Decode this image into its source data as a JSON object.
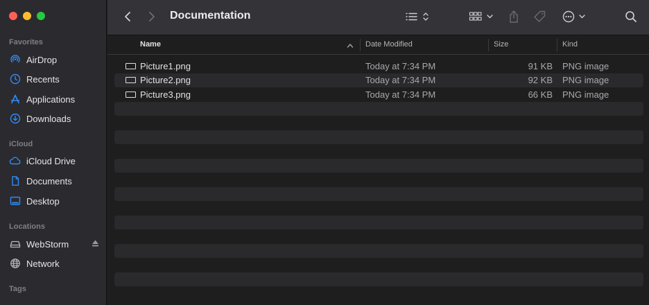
{
  "window": {
    "title": "Documentation"
  },
  "colors": {
    "accent": "#2f8cf5",
    "sidebar_bg": "#2b2a2f",
    "toolbar_bg": "#343338",
    "content_bg": "#1e1e1e"
  },
  "sidebar": {
    "sections": [
      {
        "title": "Favorites"
      },
      {
        "title": "iCloud"
      },
      {
        "title": "Locations"
      },
      {
        "title": "Tags"
      }
    ],
    "favorites": [
      {
        "label": "AirDrop",
        "icon": "airdrop-icon"
      },
      {
        "label": "Recents",
        "icon": "clock-icon"
      },
      {
        "label": "Applications",
        "icon": "applications-icon"
      },
      {
        "label": "Downloads",
        "icon": "downloads-icon"
      }
    ],
    "icloud": [
      {
        "label": "iCloud Drive",
        "icon": "cloud-icon"
      },
      {
        "label": "Documents",
        "icon": "document-icon"
      },
      {
        "label": "Desktop",
        "icon": "desktop-icon"
      }
    ],
    "locations": [
      {
        "label": "WebStorm",
        "icon": "drive-icon",
        "eject": "eject-icon"
      },
      {
        "label": "Network",
        "icon": "globe-icon"
      }
    ]
  },
  "toolbar": {
    "back": "chevron-left-icon",
    "forward": "chevron-right-icon",
    "view": "list-view-icon",
    "group": "grid-group-icon",
    "share": "share-icon",
    "tag": "tag-icon",
    "more": "ellipsis-circle-icon",
    "search": "search-icon"
  },
  "table": {
    "columns": {
      "name": "Name",
      "date": "Date Modified",
      "size": "Size",
      "kind": "Kind"
    },
    "rows": [
      {
        "name": "Picture1.png",
        "date": "Today at 7:34 PM",
        "size": "91 KB",
        "kind": "PNG image"
      },
      {
        "name": "Picture2.png",
        "date": "Today at 7:34 PM",
        "size": "92 KB",
        "kind": "PNG image"
      },
      {
        "name": "Picture3.png",
        "date": "Today at 7:34 PM",
        "size": "66 KB",
        "kind": "PNG image"
      }
    ]
  }
}
